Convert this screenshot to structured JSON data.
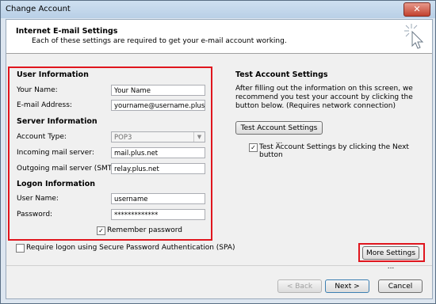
{
  "window": {
    "title": "Change Account",
    "close_glyph": "✕"
  },
  "header": {
    "title": "Internet E-mail Settings",
    "subtitle": "Each of these settings are required to get your e-mail account working."
  },
  "user_info": {
    "section_title": "User Information",
    "name_label": "Your Name:",
    "name_value": "Your Name",
    "email_label": "E-mail Address:",
    "email_value": "yourname@username.plus.com"
  },
  "server_info": {
    "section_title": "Server Information",
    "account_type_label": "Account Type:",
    "account_type_value": "POP3",
    "incoming_label": "Incoming mail server:",
    "incoming_value": "mail.plus.net",
    "outgoing_label": "Outgoing mail server (SMTP):",
    "outgoing_value": "relay.plus.net"
  },
  "logon_info": {
    "section_title": "Logon Information",
    "username_label": "User Name:",
    "username_value": "username",
    "password_label": "Password:",
    "password_value": "*************",
    "remember_label": "Remember password",
    "remember_checked": true
  },
  "spa": {
    "label": "Require logon using Secure Password Authentication (SPA)",
    "checked": false
  },
  "test": {
    "section_title": "Test Account Settings",
    "description": "After filling out the information on this screen, we recommend you test your account by clicking the button below. (Requires network connection)",
    "test_button": "Test Account Settings ...",
    "next_checkbox_label": "Test Account Settings by clicking the Next button",
    "next_checkbox_checked": true
  },
  "buttons": {
    "more_settings": "More Settings ...",
    "back": "< Back",
    "next": "Next >",
    "cancel": "Cancel"
  },
  "colors": {
    "highlight": "#e0161e"
  }
}
